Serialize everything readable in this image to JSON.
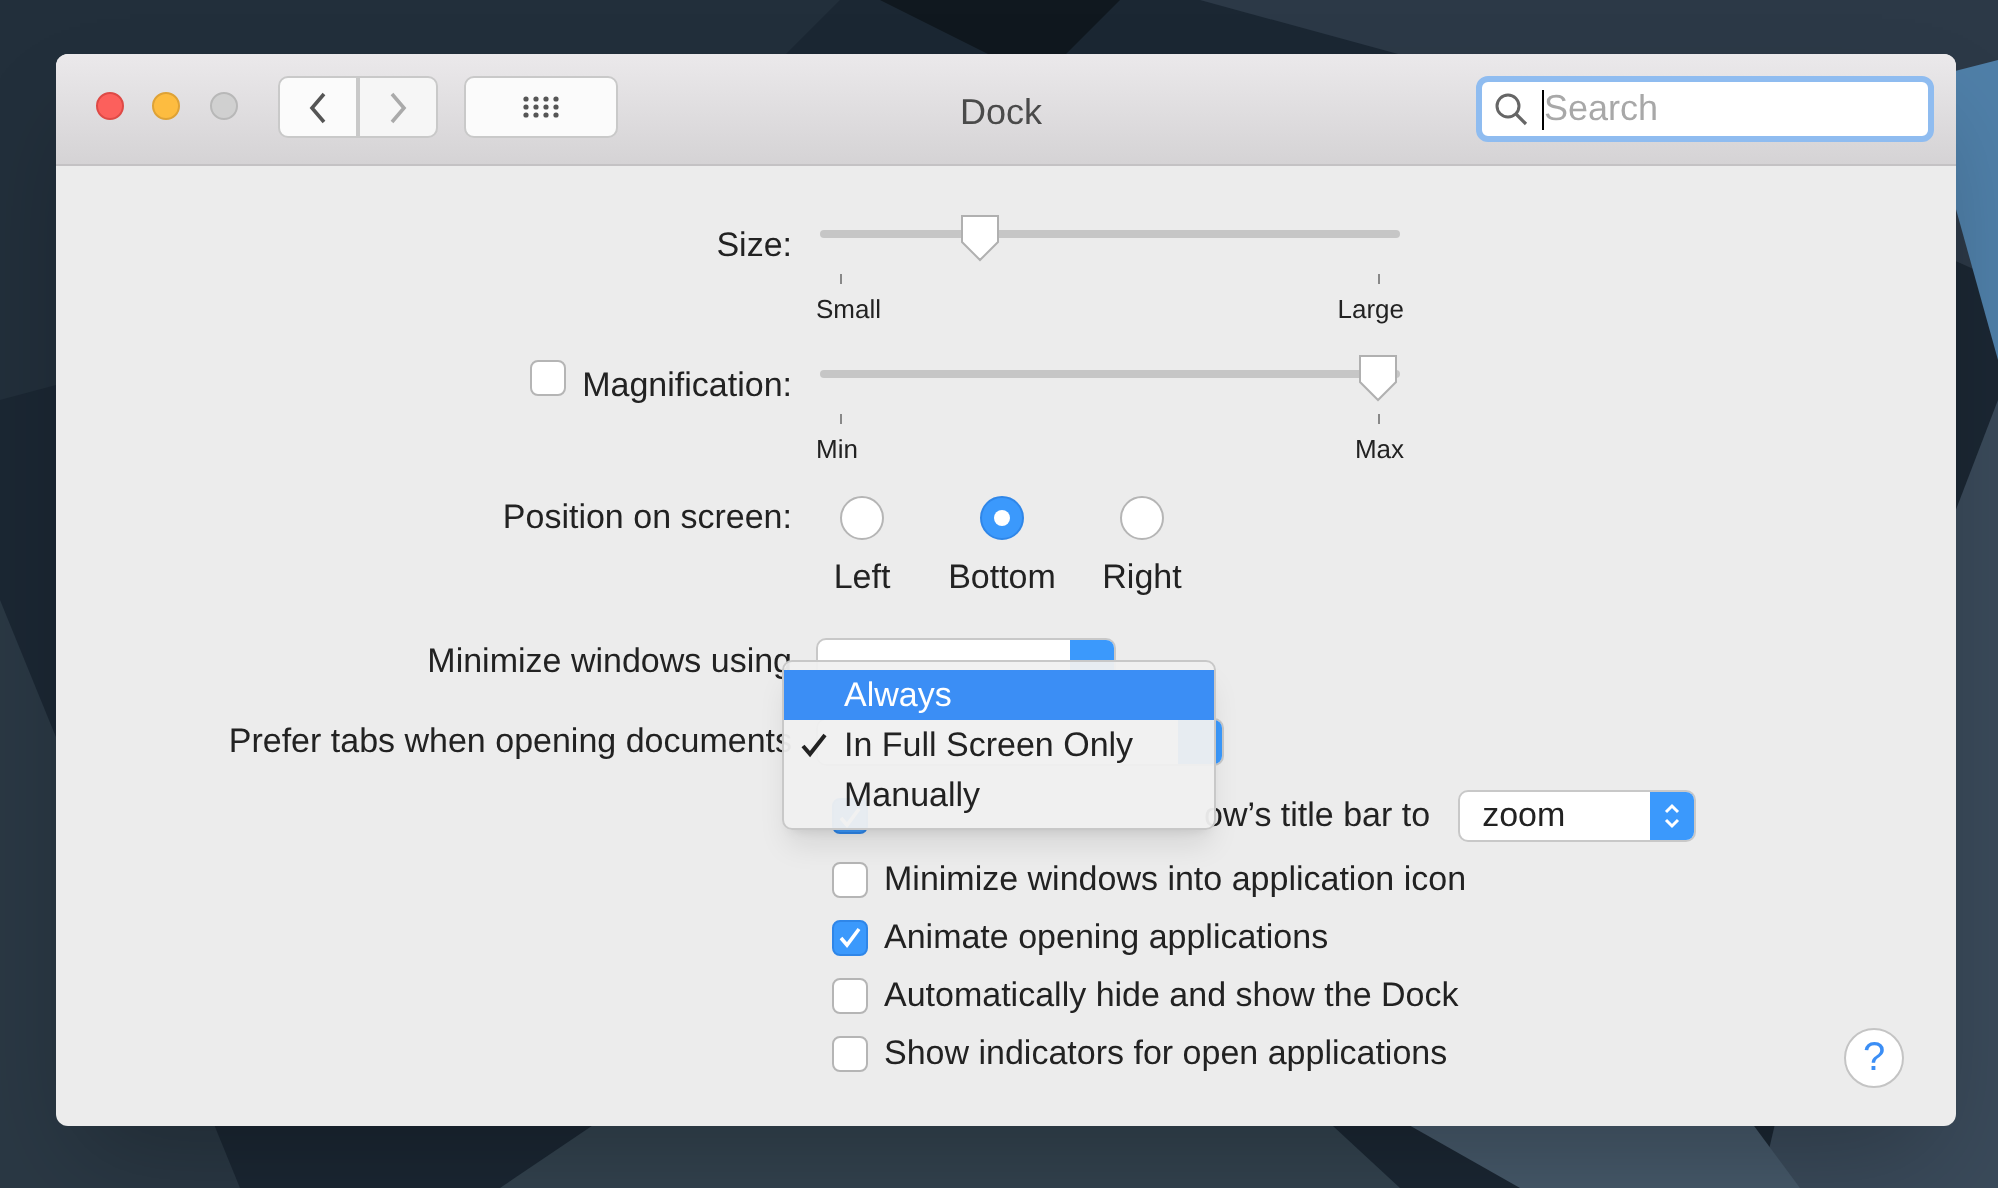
{
  "window": {
    "title": "Dock"
  },
  "search": {
    "placeholder": "Search"
  },
  "sliders": [
    {
      "label": "Size:",
      "level": 0.26,
      "min_label": "Small",
      "max_label": "Large",
      "kind": "plain"
    },
    {
      "label": "Magnification:",
      "level": 1,
      "min_label": "Min",
      "max_label": "Max",
      "kind": "checkbox",
      "checked": false
    }
  ],
  "position": {
    "label": "Position on screen:",
    "options": [
      {
        "label": "Left",
        "selected": false
      },
      {
        "label": "Bottom",
        "selected": true
      },
      {
        "label": "Right",
        "selected": false
      }
    ]
  },
  "minimize": {
    "label": "Minimize windows using"
  },
  "prefer_tabs": {
    "label": "Prefer tabs when opening documents"
  },
  "menu": [
    {
      "label": "Always",
      "selected": true,
      "checked": false
    },
    {
      "label": "In Full Screen Only",
      "selected": false,
      "checked": true
    },
    {
      "label": "Manually",
      "selected": false,
      "checked": false
    }
  ],
  "double_click": {
    "label": "ow’s title bar to",
    "checked": true,
    "value": "zoom"
  },
  "checkboxes": [
    {
      "label": "Minimize windows into application icon",
      "checked": false
    },
    {
      "label": "Animate opening applications",
      "checked": true
    },
    {
      "label": "Automatically hide and show the Dock",
      "checked": false
    },
    {
      "label": "Show indicators for open applications",
      "checked": false
    }
  ],
  "help": "?"
}
